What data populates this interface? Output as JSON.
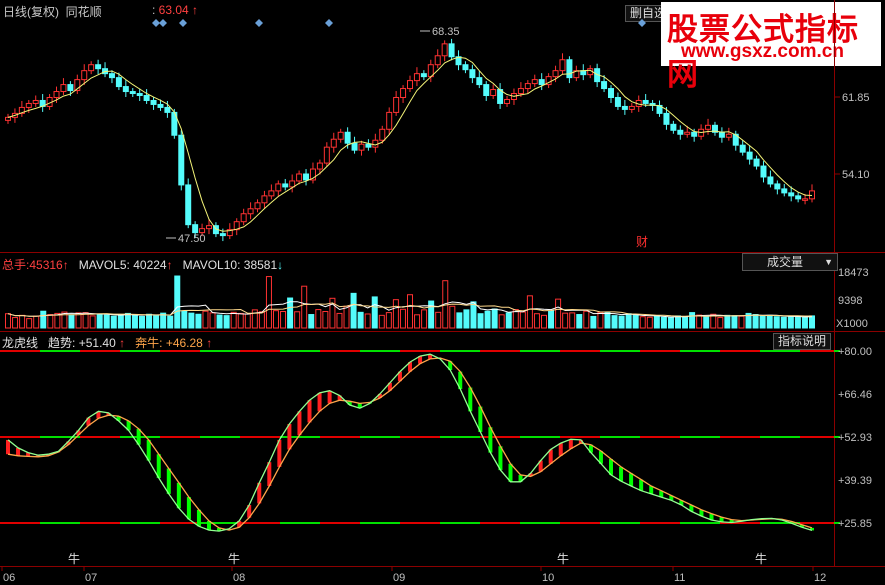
{
  "header": {
    "label": "日线(复权)",
    "name": "同花顺",
    "price": "63.04",
    "up_arrow": "↑",
    "menu": "删自选"
  },
  "watermark": {
    "title": "股票公式指标网",
    "url": "www.gsxz.com.cn"
  },
  "price_panel": {
    "high_label": "68.35",
    "low_label": "47.50",
    "axis_ticks": [
      "61.85",
      "54.10"
    ],
    "cai_label": "财"
  },
  "volume_panel": {
    "total_label": "总手:",
    "total_value": "45316",
    "mavol5_label": "MAVOL5:",
    "mavol5_value": "40224",
    "mavol10_label": "MAVOL10:",
    "mavol10_value": "38581",
    "up_arrow": "↑",
    "down_arrow": "↓",
    "dropdown_label": "成交量",
    "axis_ticks": [
      "18473",
      "9398",
      "X1000"
    ]
  },
  "indicator_panel": {
    "name": "龙虎线",
    "trend_label": "趋势:",
    "trend_value": "+51.40",
    "bull_label": "奔牛:",
    "bull_value": "+46.28",
    "up_arrow": "↑",
    "help_button": "指标说明",
    "axis_ticks": [
      "+80.00",
      "+66.46",
      "+52.93",
      "+39.39",
      "+25.85"
    ],
    "signal_label": "牛"
  },
  "x_axis": {
    "labels": [
      "06",
      "07",
      "08",
      "09",
      "10",
      "11",
      "12"
    ]
  },
  "chart_data": [
    {
      "type": "candlestick",
      "x_labels": [
        "06",
        "07",
        "08",
        "09",
        "10",
        "11",
        "12"
      ],
      "y_ticks": [
        61.85,
        54.1
      ],
      "annotated_high": 68.35,
      "annotated_low": 47.5,
      "close": [
        59.8,
        60.2,
        60.8,
        61.2,
        61.5,
        60.9,
        61.8,
        62.4,
        63.1,
        62.5,
        63.6,
        64.5,
        65.1,
        64.7,
        64.2,
        63.8,
        62.9,
        62.4,
        62.2,
        62.0,
        61.5,
        61.1,
        60.8,
        60.3,
        58.0,
        53.0,
        49.0,
        48.2,
        48.6,
        48.9,
        48.1,
        47.9,
        48.5,
        49.3,
        50.1,
        50.6,
        51.2,
        51.9,
        52.4,
        53.1,
        52.8,
        53.4,
        54.1,
        53.5,
        54.6,
        55.2,
        56.8,
        57.6,
        58.3,
        57.2,
        56.5,
        57.1,
        56.8,
        57.5,
        58.6,
        60.3,
        61.8,
        62.7,
        63.5,
        64.2,
        63.9,
        65.1,
        66.0,
        67.2,
        65.9,
        65.1,
        64.6,
        63.8,
        63.1,
        62.0,
        62.6,
        61.2,
        61.6,
        62.2,
        62.7,
        63.2,
        63.6,
        63.1,
        63.9,
        64.5,
        65.6,
        63.8,
        64.5,
        64.1,
        64.7,
        63.4,
        62.7,
        61.8,
        60.9,
        60.6,
        60.9,
        61.5,
        61.2,
        61.0,
        60.2,
        59.1,
        58.5,
        58.1,
        58.3,
        57.9,
        58.6,
        59.0,
        58.3,
        57.8,
        58.1,
        57.0,
        56.3,
        55.6,
        54.9,
        53.8,
        53.1,
        52.6,
        52.2,
        51.9,
        51.6,
        51.6,
        52.4
      ],
      "up_color": "#ff3232",
      "down_color": "#54fcfc"
    },
    {
      "type": "bar",
      "title": "成交量",
      "unit": "X1000",
      "y_ticks": [
        18473,
        9398
      ],
      "volume": [
        5200,
        3800,
        4600,
        3400,
        4300,
        6100,
        4900,
        5300,
        5800,
        4800,
        5500,
        5600,
        4400,
        5100,
        4700,
        4300,
        4900,
        5300,
        4700,
        4200,
        5000,
        4600,
        5400,
        4300,
        18900,
        6200,
        5400,
        5000,
        6100,
        5500,
        4700,
        4500,
        5700,
        5300,
        5100,
        6600,
        5900,
        18700,
        6300,
        6000,
        10900,
        5900,
        15200,
        4900,
        6700,
        6000,
        10800,
        5300,
        7900,
        12600,
        5700,
        5100,
        11300,
        4600,
        5600,
        10300,
        6800,
        12100,
        4800,
        6600,
        9800,
        5700,
        17200,
        7900,
        5500,
        6600,
        9500,
        5200,
        6100,
        6900,
        4800,
        5500,
        6700,
        5800,
        11700,
        5200,
        4600,
        6200,
        10500,
        5400,
        5500,
        4900,
        6100,
        4200,
        5700,
        5600,
        4500,
        4300,
        5200,
        4800,
        4100,
        3900,
        4300,
        3900,
        3800,
        4400,
        4100,
        5600,
        4700,
        4100,
        5000,
        3800,
        4600,
        4500,
        4300,
        5300,
        4900,
        4300,
        4600,
        4100,
        3900,
        4100,
        4200,
        3900,
        4400
      ],
      "series": [
        {
          "name": "MAVOL5",
          "last": 40224,
          "color": "#ffffff"
        },
        {
          "name": "MAVOL10",
          "last": 38581,
          "color": "#ffd98b"
        }
      ]
    },
    {
      "type": "line",
      "title": "龙虎线",
      "y_ticks": [
        80.0,
        66.46,
        52.93,
        39.39,
        25.85
      ],
      "ylim": [
        21,
        82
      ],
      "reference_lines": [
        80.0,
        52.93,
        25.85
      ],
      "series": [
        {
          "name": "趋势",
          "color": "#00ff00",
          "last": 51.4,
          "values": [
            52.0,
            49.5,
            48.0,
            47.2,
            47.5,
            48.4,
            51.5,
            55.0,
            59.0,
            61.0,
            60.5,
            58.0,
            55.0,
            50.5,
            45.5,
            40.0,
            35.0,
            30.5,
            27.0,
            24.8,
            23.6,
            23.3,
            24.0,
            26.5,
            31.5,
            38.5,
            45.0,
            52.0,
            57.0,
            61.0,
            64.5,
            66.8,
            67.5,
            66.0,
            63.0,
            62.0,
            63.5,
            66.5,
            70.0,
            73.5,
            76.5,
            78.4,
            79.0,
            77.5,
            74.0,
            68.0,
            61.0,
            54.5,
            48.0,
            42.5,
            38.8,
            38.8,
            41.5,
            45.5,
            49.0,
            51.0,
            52.2,
            52.0,
            48.0,
            44.5,
            41.0,
            39.0,
            37.5,
            36.0,
            35.0,
            34.0,
            33.0,
            31.5,
            29.5,
            28.0,
            26.8,
            26.2,
            26.0,
            26.4,
            26.9,
            27.2,
            27.3,
            26.8,
            25.7,
            24.5,
            23.5
          ]
        },
        {
          "name": "奔牛",
          "color": "#ffa54a",
          "last": 46.28,
          "values": [
            47.5,
            47.0,
            46.8,
            46.7,
            47.0,
            48.2,
            50.5,
            53.5,
            56.5,
            58.8,
            59.8,
            59.5,
            58.0,
            55.5,
            52.0,
            47.5,
            43.0,
            38.5,
            34.0,
            30.0,
            26.5,
            24.3,
            23.6,
            24.5,
            27.5,
            32.0,
            37.5,
            43.5,
            49.0,
            53.5,
            57.5,
            61.0,
            63.5,
            64.5,
            64.2,
            63.5,
            63.8,
            65.2,
            67.5,
            70.5,
            73.5,
            76.0,
            77.5,
            77.8,
            76.8,
            73.5,
            68.5,
            62.5,
            56.0,
            50.0,
            44.5,
            41.0,
            40.5,
            42.0,
            44.5,
            47.0,
            49.2,
            51.0,
            50.5,
            48.5,
            46.0,
            43.5,
            41.5,
            39.5,
            37.5,
            36.0,
            34.5,
            33.0,
            31.5,
            30.0,
            28.8,
            27.7,
            26.9,
            26.6,
            26.8,
            27.0,
            27.2,
            27.0,
            26.3,
            25.3,
            24.3
          ]
        }
      ]
    }
  ]
}
